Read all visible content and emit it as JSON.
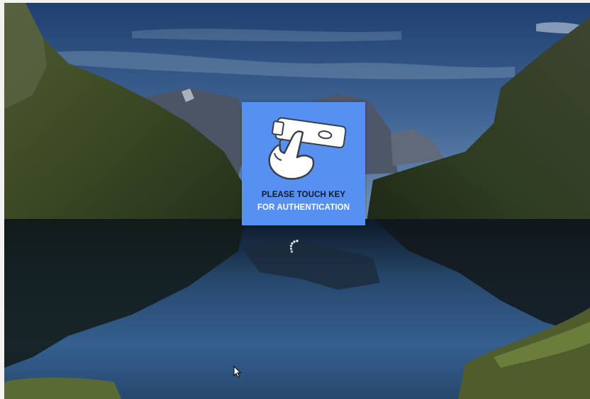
{
  "auth_prompt": {
    "line1": "PLEASE TOUCH KEY",
    "line2": "FOR AUTHENTICATION",
    "icon": "hand-touching-security-key-icon",
    "tile_color": "#5690f0"
  },
  "status": {
    "icon": "loading-spinner-icon"
  },
  "pointer": {
    "icon": "mouse-cursor-icon"
  },
  "background": {
    "description_icon": "lake-mountains-wallpaper"
  }
}
